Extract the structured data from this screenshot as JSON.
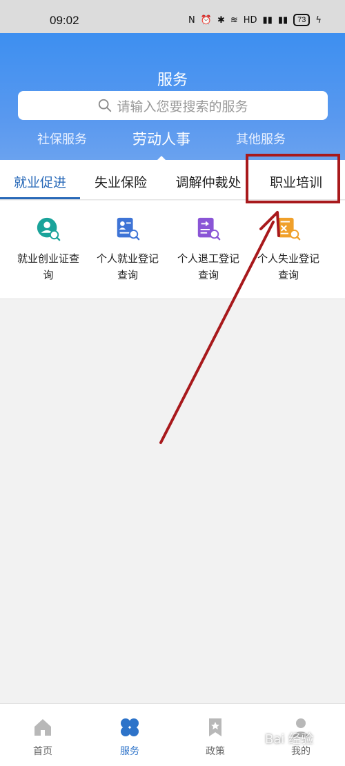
{
  "status": {
    "time": "09:02",
    "battery": "73"
  },
  "header": {
    "title": "服务"
  },
  "search": {
    "placeholder": "请输入您要搜索的服务"
  },
  "top_tabs": [
    "社保服务",
    "劳动人事",
    "其他服务"
  ],
  "sub_tabs": [
    "就业促进",
    "失业保险",
    "调解仲裁处",
    "职业培训"
  ],
  "grid_items": [
    {
      "line1": "就业创业证查",
      "line2": "询",
      "icon": "person-search-icon",
      "color": "#1aa39a"
    },
    {
      "line1": "个人就业登记",
      "line2": "查询",
      "icon": "id-card-search-icon",
      "color": "#3e74d6"
    },
    {
      "line1": "个人退工登记",
      "line2": "查询",
      "icon": "exit-record-search-icon",
      "color": "#8a55d6"
    },
    {
      "line1": "个人失业登记",
      "line2": "查询",
      "icon": "unemployment-search-icon",
      "color": "#f0a02a"
    }
  ],
  "bottom_nav": [
    {
      "label": "首页",
      "icon": "home-icon"
    },
    {
      "label": "服务",
      "icon": "clover-icon"
    },
    {
      "label": "政策",
      "icon": "bookmark-icon"
    },
    {
      "label": "我的",
      "icon": "user-icon"
    }
  ],
  "colors": {
    "accent": "#2869b8",
    "header": "#4a93ef",
    "annotation": "#a8191c"
  },
  "watermark": "Bai 经验"
}
